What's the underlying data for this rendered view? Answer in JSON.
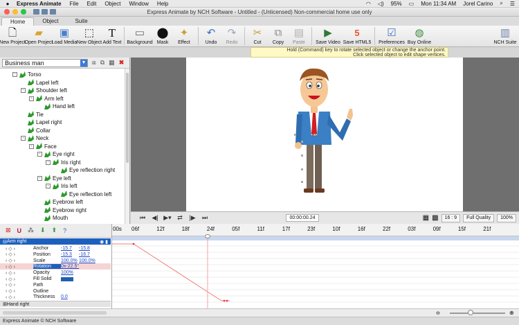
{
  "menubar": {
    "app": "Express Animate",
    "items": [
      "File",
      "Edit",
      "Object",
      "Window",
      "Help"
    ],
    "battery": "95%",
    "clock": "Mon 11:34 AM",
    "user": "Jorel Carino"
  },
  "window": {
    "title": "Express Animate by NCH Software - Untitled - (Unlicensed) Non-commercial home use only"
  },
  "tabs": [
    "Home",
    "Object",
    "Suite"
  ],
  "ribbon": {
    "new_project": "New Project",
    "open_project": "Open Project",
    "load_media": "Load Media",
    "new_object": "New Object",
    "add_text": "Add Text",
    "background": "Background",
    "mask": "Mask",
    "effect": "Effect",
    "undo": "Undo",
    "redo": "Redo",
    "cut": "Cut",
    "copy": "Copy",
    "paste": "Paste",
    "save_video": "Save Video",
    "save_html5": "Save HTML5",
    "preferences": "Preferences",
    "buy_online": "Buy Online",
    "nch_suite": "NCH Suite"
  },
  "hint": {
    "line1": "Hold (Command) key to rotate selected object or change the anchor point.",
    "line2": "Click selected object to edit shape vertices."
  },
  "object_selector": "Business man",
  "tree": [
    {
      "label": "Torso",
      "indent": 0,
      "expander": "-"
    },
    {
      "label": "Lapel left",
      "indent": 1,
      "expander": ""
    },
    {
      "label": "Shoulder left",
      "indent": 1,
      "expander": "-"
    },
    {
      "label": "Arm left",
      "indent": 2,
      "expander": "-"
    },
    {
      "label": "Hand left",
      "indent": 3,
      "expander": ""
    },
    {
      "label": "Tie",
      "indent": 1,
      "expander": ""
    },
    {
      "label": "Lapel right",
      "indent": 1,
      "expander": ""
    },
    {
      "label": "Collar",
      "indent": 1,
      "expander": ""
    },
    {
      "label": "Neck",
      "indent": 1,
      "expander": "-"
    },
    {
      "label": "Face",
      "indent": 2,
      "expander": "-"
    },
    {
      "label": "Eye right",
      "indent": 3,
      "expander": "-"
    },
    {
      "label": "Iris right",
      "indent": 4,
      "expander": "-"
    },
    {
      "label": "Eye reflection right",
      "indent": 5,
      "expander": ""
    },
    {
      "label": "Eye left",
      "indent": 3,
      "expander": "-"
    },
    {
      "label": "Iris left",
      "indent": 4,
      "expander": "-"
    },
    {
      "label": "Eye reflection left",
      "indent": 5,
      "expander": ""
    },
    {
      "label": "Eyebrow left",
      "indent": 3,
      "expander": ""
    },
    {
      "label": "Eyebrow right",
      "indent": 3,
      "expander": ""
    },
    {
      "label": "Mouth",
      "indent": 3,
      "expander": ""
    }
  ],
  "player": {
    "time": "00:00:00.24",
    "ratio": "16 : 9",
    "quality": "Full Quality",
    "zoom": "100%"
  },
  "properties": {
    "group": "Arm right",
    "next_group": "Hand right",
    "rows": [
      {
        "name": "Anchor",
        "v1": "-15.7",
        "v2": "-15.8"
      },
      {
        "name": "Position",
        "v1": "-15.3",
        "v2": "-16.7"
      },
      {
        "name": "Scale",
        "v1": "100.0%",
        "v2": "100.0%"
      },
      {
        "name": "Rotation",
        "v1": "0x-22.5°",
        "v2": ""
      },
      {
        "name": "Opacity",
        "v1": "100%",
        "v2": ""
      },
      {
        "name": "Fill Solid",
        "v1": "",
        "v2": ""
      },
      {
        "name": "Path",
        "v1": "",
        "v2": ""
      },
      {
        "name": "Outline",
        "v1": "",
        "v2": ""
      },
      {
        "name": "Thickness",
        "v1": "0.0",
        "v2": ""
      }
    ]
  },
  "ruler": [
    "00s",
    "06f",
    "12f",
    "18f",
    "24f",
    "05f",
    "11f",
    "17f",
    "23f",
    "10f",
    "16f",
    "22f",
    "03f",
    "09f",
    "15f",
    "21f"
  ],
  "status": "Express Animate © NCH Software",
  "colors": {
    "accent": "#1d5fbd",
    "figure_green": "#2e9a2e",
    "keyframe_line": "#f08080"
  }
}
